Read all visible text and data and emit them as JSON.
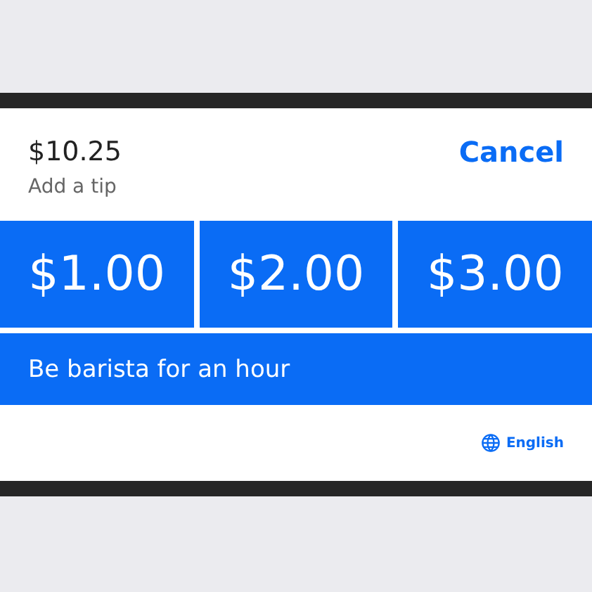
{
  "total": "$10.25",
  "prompt": "Add a tip",
  "cancel": "Cancel",
  "tips": [
    {
      "label": "$1.00"
    },
    {
      "label": "$2.00"
    },
    {
      "label": "$3.00"
    }
  ],
  "custom_option": "Be barista for an hour",
  "language": "English"
}
